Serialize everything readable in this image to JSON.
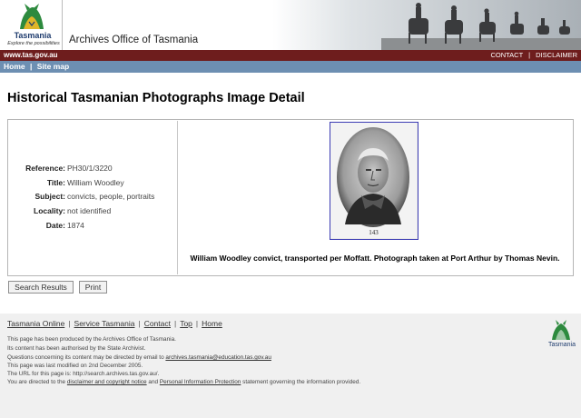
{
  "header": {
    "logo_word": "Tasmania",
    "logo_tagline": "Explore the possibilities",
    "site_title": "Archives Office of Tasmania",
    "url": "www.tas.gov.au",
    "links": [
      "CONTACT",
      "DISCLAIMER"
    ],
    "link_separator": "|"
  },
  "nav": {
    "items": [
      "Home",
      "Site map"
    ],
    "separator": "|"
  },
  "page": {
    "title": "Historical Tasmanian Photographs Image Detail"
  },
  "record": {
    "fields": [
      {
        "label": "Reference:",
        "value": "PH30/1/3220"
      },
      {
        "label": "Title:",
        "value": "William Woodley"
      },
      {
        "label": "Subject:",
        "value": "convicts, people, portraits"
      },
      {
        "label": "Locality:",
        "value": "not identified"
      },
      {
        "label": "Date:",
        "value": "1874"
      }
    ],
    "photo_number": "143",
    "caption": "William Woodley convict, transported per Moffatt. Photograph taken at Port Arthur by Thomas Nevin."
  },
  "buttons": {
    "search_results": "Search Results",
    "print": "Print"
  },
  "footer": {
    "links": [
      "Tasmania Online",
      "Service Tasmania",
      "Contact",
      "Top",
      "Home"
    ],
    "separator": "|",
    "line1": "This page has been produced by the Archives Office of Tasmania.",
    "line2": "Its content has been authorised by the State Archivist.",
    "line3_prefix": "Questions concerning its content may be directed by email to ",
    "line3_email": "archives.tasmania@education.tas.gov.au",
    "line4": "This page was last modified on 2nd December 2005.",
    "line5": "The URL for this page is: http://search.archives.tas.gov.au/.",
    "line6_prefix": "You are directed to the ",
    "line6_link1": "disclaimer and copyright notice",
    "line6_mid": " and ",
    "line6_link2": "Personal Information Protection",
    "line6_suffix": " statement governing the information provided.",
    "logo_word": "Tasmania"
  },
  "colors": {
    "red_bar": "#6e1d1d",
    "blue_bar": "#6d8fb2",
    "photo_border": "#3b3bb3",
    "footer_bg": "#f0f0f0"
  }
}
